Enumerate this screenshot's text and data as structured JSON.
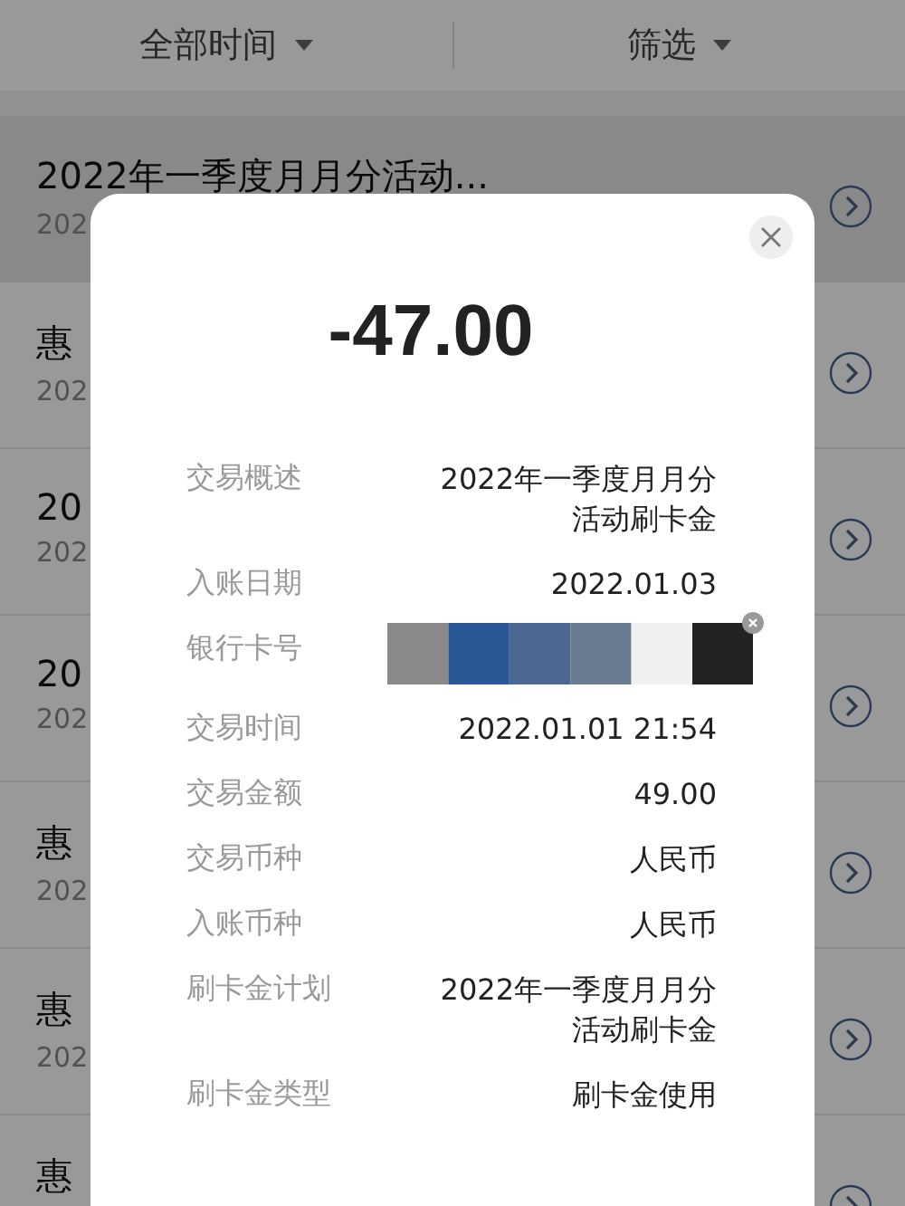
{
  "filter_bar": {
    "time_filter": "全部时间",
    "filter": "筛选"
  },
  "list": [
    {
      "title": "2022年一季度月月分活动...",
      "subtitle": "202",
      "selected": true
    },
    {
      "title": "惠",
      "subtitle": "202",
      "selected": false
    },
    {
      "title": "20",
      "subtitle": "202",
      "selected": false
    },
    {
      "title": "20",
      "subtitle": "202",
      "selected": false
    },
    {
      "title": "惠",
      "subtitle": "202",
      "selected": false
    },
    {
      "title": "惠",
      "subtitle": "202",
      "selected": false
    },
    {
      "title": "惠",
      "selected": false
    }
  ],
  "dialog": {
    "amount": "-47.00",
    "fields": [
      {
        "label": "交易概述",
        "value": "2022年一季度月月分活动刷卡金",
        "kind": "text"
      },
      {
        "label": "入账日期",
        "value": "2022.01.03",
        "kind": "text"
      },
      {
        "label": "银行卡号",
        "kind": "redacted"
      },
      {
        "label": "交易时间",
        "value": "2022.01.01 21:54",
        "kind": "text"
      },
      {
        "label": "交易金额",
        "value": "49.00",
        "kind": "text"
      },
      {
        "label": "交易币种",
        "value": "人民币",
        "kind": "text"
      },
      {
        "label": "入账币种",
        "value": "人民币",
        "kind": "text"
      },
      {
        "label": "刷卡金计划",
        "value": "2022年一季度月月分活动刷卡金",
        "kind": "text"
      },
      {
        "label": "刷卡金类型",
        "value": "刷卡金使用",
        "kind": "text"
      }
    ]
  }
}
